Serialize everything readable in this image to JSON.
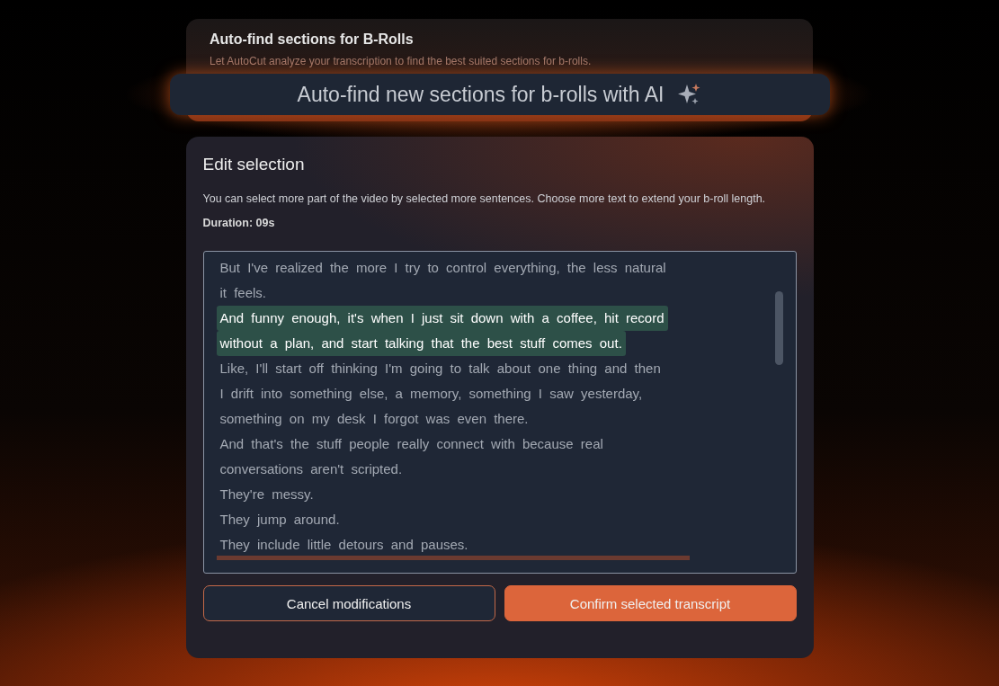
{
  "header_card": {
    "title": "Auto-find sections for B-Rolls",
    "description": "Let AutoCut analyze your transcription to find the best suited sections for b-rolls."
  },
  "ai_button": {
    "label": "Auto-find new sections for b-rolls with AI"
  },
  "edit_panel": {
    "title": "Edit selection",
    "description": "You can select more part of the video by selected more sentences. Choose more text to extend your b-roll length.",
    "duration": "Duration: 09s",
    "transcript": [
      {
        "text": "But I've realized the more I try to control everything, the less natural",
        "selected": false
      },
      {
        "text": "it feels.",
        "selected": false
      },
      {
        "text": "And funny enough, it's when I just sit down with a coffee, hit record",
        "selected": true
      },
      {
        "text": "without a plan, and start talking that the best stuff comes out.",
        "selected": true
      },
      {
        "text": "Like, I'll start off thinking I'm going to talk about one thing and then",
        "selected": false
      },
      {
        "text": "I drift into something else, a memory, something I saw yesterday,",
        "selected": false
      },
      {
        "text": "something on my desk I forgot was even there.",
        "selected": false
      },
      {
        "text": "And that's the stuff people really connect with because real",
        "selected": false
      },
      {
        "text": "conversations aren't scripted.",
        "selected": false
      },
      {
        "text": "They're messy.",
        "selected": false
      },
      {
        "text": "They jump around.",
        "selected": false
      },
      {
        "text": "They include little detours and pauses.",
        "selected": false
      }
    ],
    "buttons": [
      {
        "kind": "secondary",
        "label": "Cancel modifications"
      },
      {
        "kind": "primary",
        "label": "Confirm selected transcript"
      }
    ]
  }
}
